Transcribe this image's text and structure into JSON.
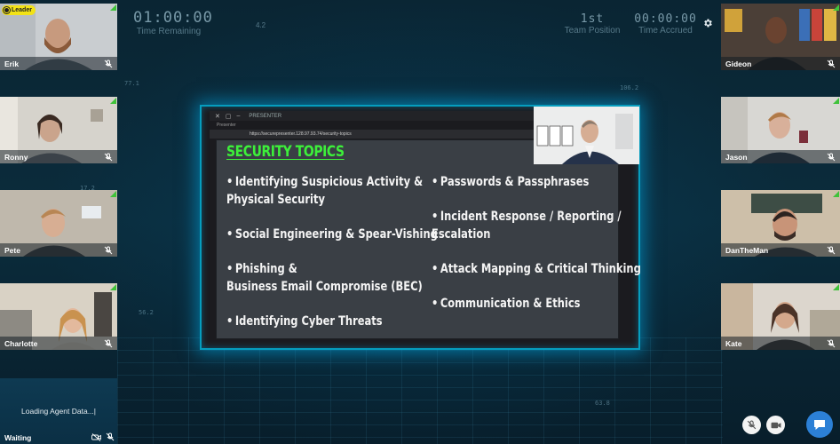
{
  "hud": {
    "time_remaining_value": "01:00:00",
    "time_remaining_label": "Time Remaining",
    "team_position_value": "1st",
    "team_position_label": "Team Position",
    "time_accrued_value": "00:00:00",
    "time_accrued_label": "Time Accrued",
    "center_small": "4.2"
  },
  "leader_badge": "Leader",
  "left_participants": [
    {
      "name": "Erik"
    },
    {
      "name": "Ronny"
    },
    {
      "name": "Pete"
    },
    {
      "name": "Charlotte"
    }
  ],
  "right_participants": [
    {
      "name": "Gideon"
    },
    {
      "name": "Jason"
    },
    {
      "name": "DanTheMan"
    },
    {
      "name": "Kate"
    }
  ],
  "waiting_tile": {
    "loading_text": "Loading Agent Data...|",
    "name": "Waiting"
  },
  "presenter": {
    "window_title": "PRESENTER",
    "tab_label": "Presenter",
    "url": "https://securepresenter.128.97.93.74/security-topics",
    "slide_title": "SECURITY TOPICS",
    "topics_left": [
      "Identifying Suspicious Activity &\nPhysical Security",
      "Social Engineering & Spear-Vishing",
      "Phishing &\nBusiness Email Compromise (BEC)",
      "Identifying Cyber Threats"
    ],
    "topics_right": [
      "Passwords & Passphrases",
      "Incident Response / Reporting /\nEscalation",
      "Attack Mapping & Critical Thinking",
      "Communication & Ethics"
    ]
  },
  "deco_numbers": [
    "106.2",
    "56.2",
    "63.8",
    "17.2",
    "77.1"
  ],
  "icons": {
    "settings": "gear-icon",
    "mic_off": "mic-off-icon",
    "camera": "camera-icon",
    "chat": "chat-icon"
  },
  "colors": {
    "accent_glow": "#00bee6",
    "slide_title_green": "#3df03a",
    "leader_yellow": "#f2e216",
    "signal_green": "#3fc23a",
    "chat_blue": "#2c80d6"
  }
}
